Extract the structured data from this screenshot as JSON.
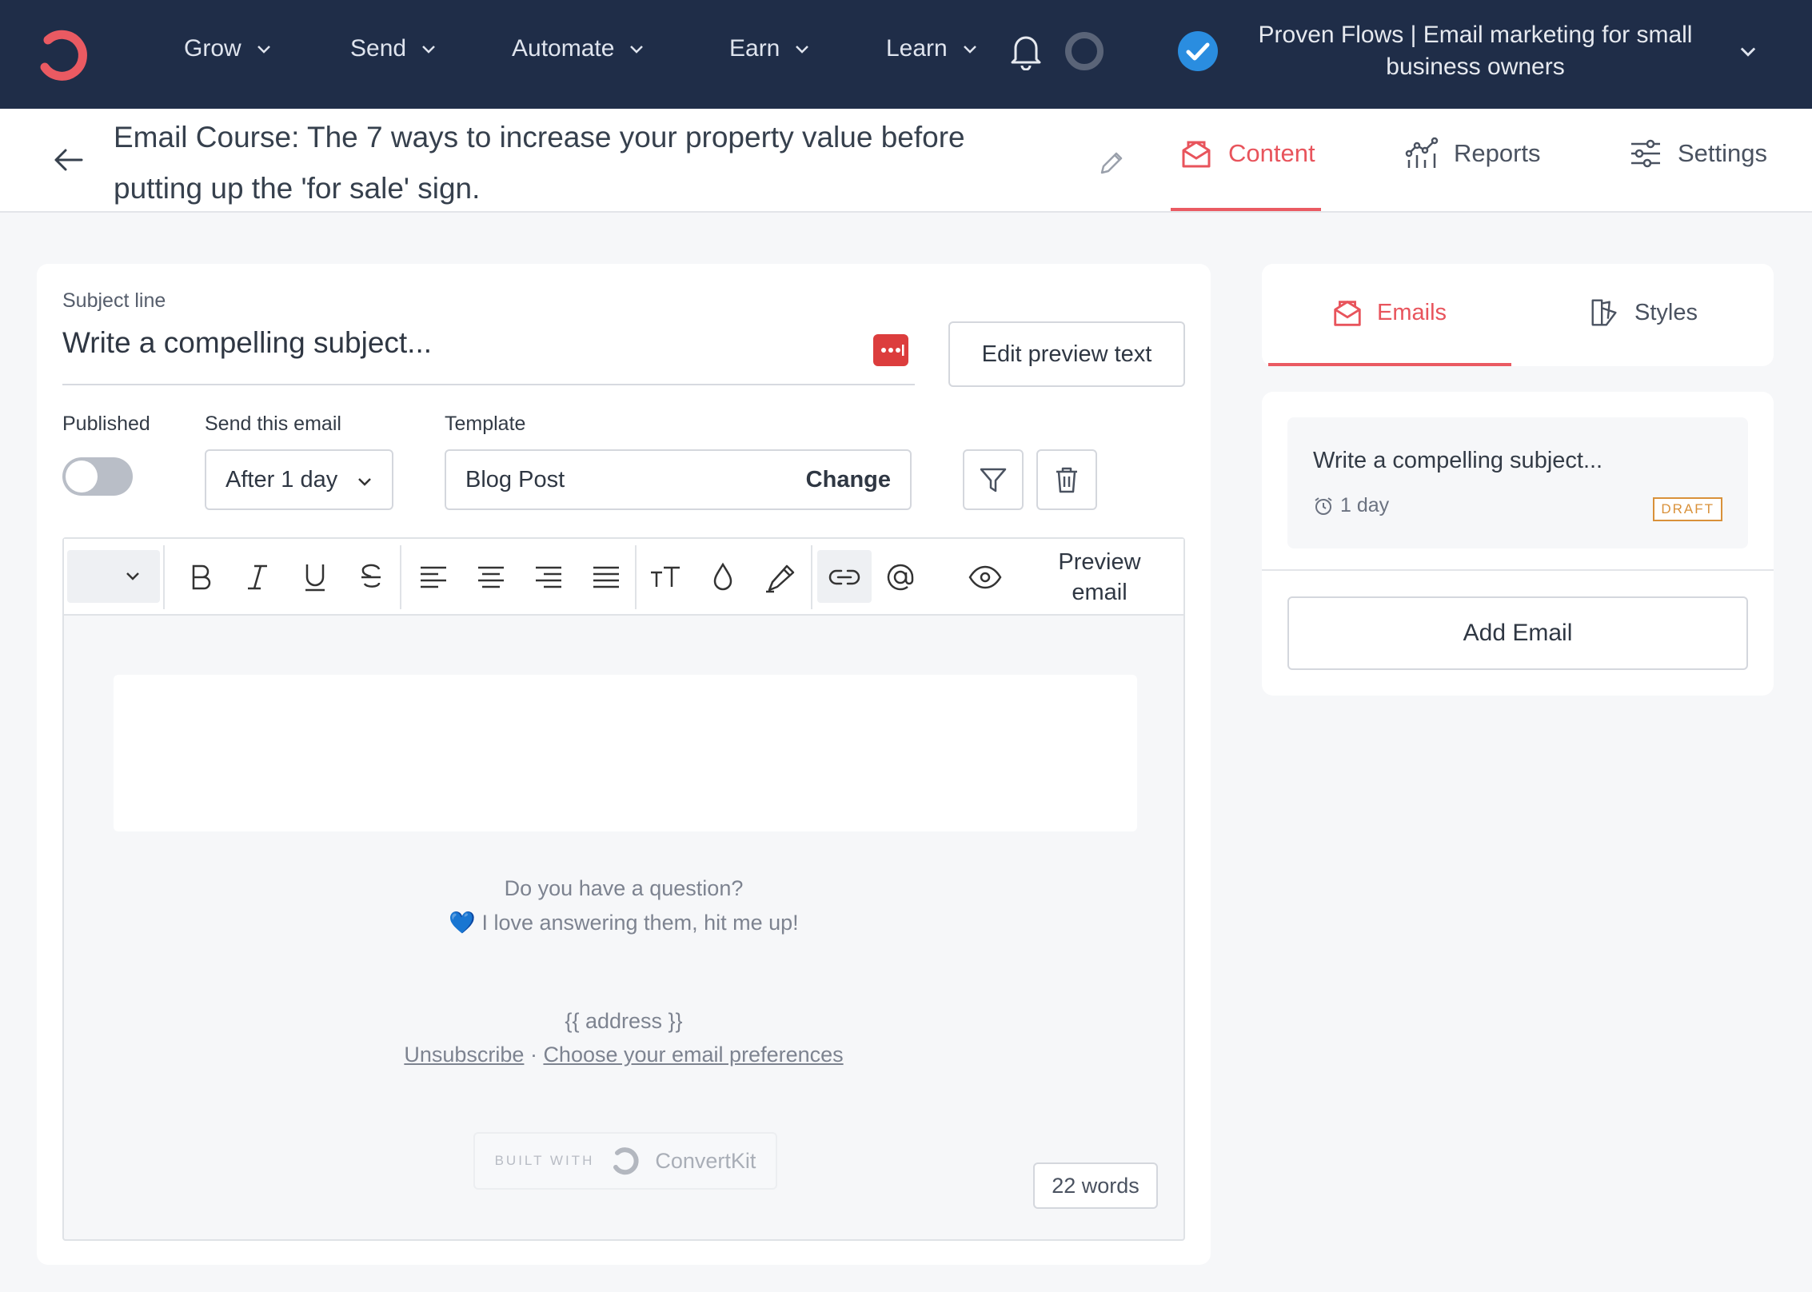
{
  "nav": {
    "items": [
      {
        "label": "Grow"
      },
      {
        "label": "Send"
      },
      {
        "label": "Automate"
      },
      {
        "label": "Earn"
      },
      {
        "label": "Learn"
      }
    ],
    "account_line1": "Proven Flows | Email marketing for small",
    "account_line2": "business owners",
    "accent": "#ea5a62",
    "bg": "#1f2d48"
  },
  "header": {
    "title_line1": "Email Course: The 7 ways to increase your property value before",
    "title_line2": "putting up the 'for sale' sign.",
    "tabs": [
      {
        "label": "Content",
        "icon": "content-icon",
        "active": true
      },
      {
        "label": "Reports",
        "icon": "reports-icon",
        "active": false
      },
      {
        "label": "Settings",
        "icon": "settings-icon",
        "active": false
      }
    ]
  },
  "editor_card": {
    "subject_label": "Subject line",
    "subject_value": "Write a compelling subject...",
    "edit_preview_label": "Edit preview text",
    "published_label": "Published",
    "published": false,
    "send_label": "Send this email",
    "send_value": "After 1 day",
    "template_label": "Template",
    "template_value": "Blog Post",
    "change_label": "Change",
    "preview_email_line1": "Preview",
    "preview_email_line2": "email",
    "footer_q": "Do you have a question?",
    "footer_love": "💙 I love answering them, hit me up!",
    "footer_address": "{{ address }}",
    "unsubscribe": "Unsubscribe",
    "dot": " · ",
    "preferences": "Choose your email preferences",
    "built_with": "BUILT WITH",
    "brand": "ConvertKit",
    "word_count": "22 words"
  },
  "right_panel": {
    "tabs": [
      {
        "label": "Emails",
        "icon": "emails-icon",
        "active": true
      },
      {
        "label": "Styles",
        "icon": "styles-icon",
        "active": false
      }
    ],
    "email_subject": "Write a compelling subject...",
    "email_delay": "1 day",
    "email_status": "DRAFT",
    "add_email_label": "Add Email"
  }
}
